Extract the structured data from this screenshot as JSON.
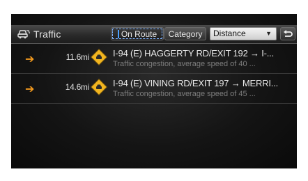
{
  "header": {
    "title": "Traffic",
    "tabs": [
      {
        "label": "On Route",
        "selected": true
      },
      {
        "label": "Category",
        "selected": false
      }
    ],
    "sort": {
      "selected": "Distance"
    },
    "back_icon": "back-icon"
  },
  "colors": {
    "accent_orange": "#f39a1e",
    "warning_yellow": "#f2b51f",
    "focus_blue": "#4aa0ff"
  },
  "items": [
    {
      "direction_icon": "right-arrow-icon",
      "distance": "11.6mi",
      "warning_icon": "road-warning-icon",
      "road": "I-94 (E) HAGGERTY RD/EXIT  192 → I-...",
      "description": "Traffic congestion, average speed of 40 ..."
    },
    {
      "direction_icon": "right-arrow-icon",
      "distance": "14.6mi",
      "warning_icon": "road-warning-icon",
      "road": "I-94 (E) VINING RD/EXIT  197 → MERRI...",
      "description": "Traffic congestion, average speed of 45 ..."
    }
  ]
}
